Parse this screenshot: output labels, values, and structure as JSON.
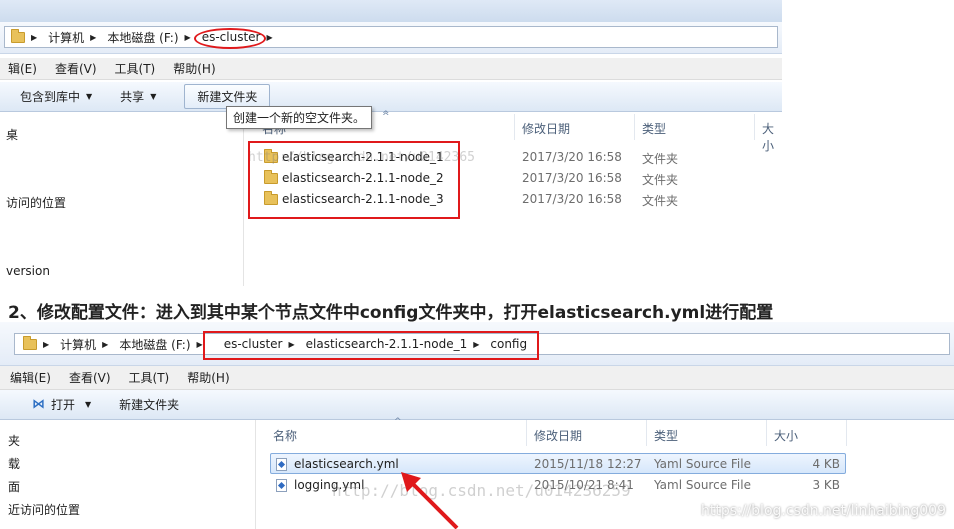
{
  "top_window": {
    "breadcrumb": [
      "计算机",
      "本地磁盘 (F:)",
      "es-cluster"
    ],
    "menu": [
      "编辑(E)",
      "查看(V)",
      "工具(T)",
      "帮助(H)"
    ],
    "menu_first_partial": "辑(E)",
    "toolbar": {
      "include_library": "包含到库中",
      "share": "共享",
      "new_folder": "新建文件夹"
    },
    "tooltip": "创建一个新的空文件夹。",
    "columns": {
      "name": "名称",
      "date": "修改日期",
      "type": "类型",
      "size": "大小"
    },
    "nav_items": [
      "桌",
      "访问的位置",
      "version"
    ],
    "files": [
      {
        "name": "elasticsearch-2.1.1-node_1",
        "date": "2017/3/20 16:58",
        "type": "文件夹"
      },
      {
        "name": "elasticsearch-2.1.1-node_2",
        "date": "2017/3/20 16:58",
        "type": "文件夹"
      },
      {
        "name": "elasticsearch-2.1.1-node_3",
        "date": "2017/3/20 16:58",
        "type": "文件夹"
      }
    ]
  },
  "heading": "2、修改配置文件：进入到其中某个节点文件中config文件夹中，打开elasticsearch.yml进行配置",
  "bottom_window": {
    "breadcrumb": [
      "计算机",
      "本地磁盘 (F:)",
      "es-cluster",
      "elasticsearch-2.1.1-node_1",
      "config"
    ],
    "menu": [
      "编辑(E)",
      "查看(V)",
      "工具(T)",
      "帮助(H)"
    ],
    "toolbar": {
      "open": "打开",
      "new_folder": "新建文件夹"
    },
    "columns": {
      "name": "名称",
      "date": "修改日期",
      "type": "类型",
      "size": "大小"
    },
    "nav_items": [
      "夹",
      "载",
      "面",
      "近访问的位置"
    ],
    "files": [
      {
        "name": "elasticsearch.yml",
        "date": "2015/11/18 12:27",
        "type": "Yaml Source File",
        "size": "4 KB"
      },
      {
        "name": "logging.yml",
        "date": "2015/10/21 8:41",
        "type": "Yaml Source File",
        "size": "3 KB"
      }
    ]
  },
  "watermarks": {
    "top": "http://blog.csdn.net/u0142365",
    "bottom": "http://blog.csdn.net/u014236259",
    "corner": "https://blog.csdn.net/linhaibing009"
  },
  "colors": {
    "annotation_red": "#e0191b",
    "selection_blue": "#d6e7fb"
  }
}
